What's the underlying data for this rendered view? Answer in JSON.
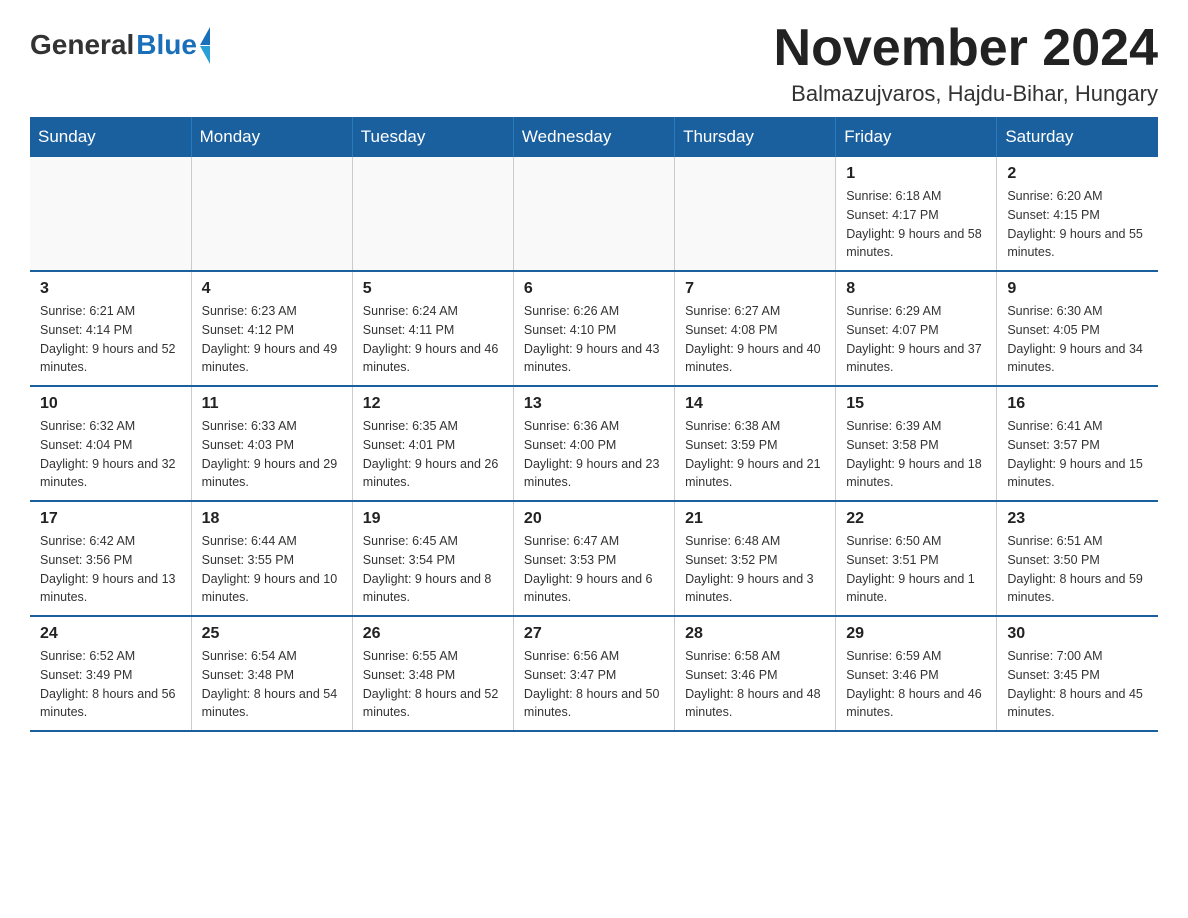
{
  "header": {
    "logo": {
      "general": "General",
      "blue": "Blue"
    },
    "title": "November 2024",
    "location": "Balmazujvaros, Hajdu-Bihar, Hungary"
  },
  "weekdays": [
    "Sunday",
    "Monday",
    "Tuesday",
    "Wednesday",
    "Thursday",
    "Friday",
    "Saturday"
  ],
  "weeks": [
    [
      {
        "day": "",
        "info": ""
      },
      {
        "day": "",
        "info": ""
      },
      {
        "day": "",
        "info": ""
      },
      {
        "day": "",
        "info": ""
      },
      {
        "day": "",
        "info": ""
      },
      {
        "day": "1",
        "info": "Sunrise: 6:18 AM\nSunset: 4:17 PM\nDaylight: 9 hours and 58 minutes."
      },
      {
        "day": "2",
        "info": "Sunrise: 6:20 AM\nSunset: 4:15 PM\nDaylight: 9 hours and 55 minutes."
      }
    ],
    [
      {
        "day": "3",
        "info": "Sunrise: 6:21 AM\nSunset: 4:14 PM\nDaylight: 9 hours and 52 minutes."
      },
      {
        "day": "4",
        "info": "Sunrise: 6:23 AM\nSunset: 4:12 PM\nDaylight: 9 hours and 49 minutes."
      },
      {
        "day": "5",
        "info": "Sunrise: 6:24 AM\nSunset: 4:11 PM\nDaylight: 9 hours and 46 minutes."
      },
      {
        "day": "6",
        "info": "Sunrise: 6:26 AM\nSunset: 4:10 PM\nDaylight: 9 hours and 43 minutes."
      },
      {
        "day": "7",
        "info": "Sunrise: 6:27 AM\nSunset: 4:08 PM\nDaylight: 9 hours and 40 minutes."
      },
      {
        "day": "8",
        "info": "Sunrise: 6:29 AM\nSunset: 4:07 PM\nDaylight: 9 hours and 37 minutes."
      },
      {
        "day": "9",
        "info": "Sunrise: 6:30 AM\nSunset: 4:05 PM\nDaylight: 9 hours and 34 minutes."
      }
    ],
    [
      {
        "day": "10",
        "info": "Sunrise: 6:32 AM\nSunset: 4:04 PM\nDaylight: 9 hours and 32 minutes."
      },
      {
        "day": "11",
        "info": "Sunrise: 6:33 AM\nSunset: 4:03 PM\nDaylight: 9 hours and 29 minutes."
      },
      {
        "day": "12",
        "info": "Sunrise: 6:35 AM\nSunset: 4:01 PM\nDaylight: 9 hours and 26 minutes."
      },
      {
        "day": "13",
        "info": "Sunrise: 6:36 AM\nSunset: 4:00 PM\nDaylight: 9 hours and 23 minutes."
      },
      {
        "day": "14",
        "info": "Sunrise: 6:38 AM\nSunset: 3:59 PM\nDaylight: 9 hours and 21 minutes."
      },
      {
        "day": "15",
        "info": "Sunrise: 6:39 AM\nSunset: 3:58 PM\nDaylight: 9 hours and 18 minutes."
      },
      {
        "day": "16",
        "info": "Sunrise: 6:41 AM\nSunset: 3:57 PM\nDaylight: 9 hours and 15 minutes."
      }
    ],
    [
      {
        "day": "17",
        "info": "Sunrise: 6:42 AM\nSunset: 3:56 PM\nDaylight: 9 hours and 13 minutes."
      },
      {
        "day": "18",
        "info": "Sunrise: 6:44 AM\nSunset: 3:55 PM\nDaylight: 9 hours and 10 minutes."
      },
      {
        "day": "19",
        "info": "Sunrise: 6:45 AM\nSunset: 3:54 PM\nDaylight: 9 hours and 8 minutes."
      },
      {
        "day": "20",
        "info": "Sunrise: 6:47 AM\nSunset: 3:53 PM\nDaylight: 9 hours and 6 minutes."
      },
      {
        "day": "21",
        "info": "Sunrise: 6:48 AM\nSunset: 3:52 PM\nDaylight: 9 hours and 3 minutes."
      },
      {
        "day": "22",
        "info": "Sunrise: 6:50 AM\nSunset: 3:51 PM\nDaylight: 9 hours and 1 minute."
      },
      {
        "day": "23",
        "info": "Sunrise: 6:51 AM\nSunset: 3:50 PM\nDaylight: 8 hours and 59 minutes."
      }
    ],
    [
      {
        "day": "24",
        "info": "Sunrise: 6:52 AM\nSunset: 3:49 PM\nDaylight: 8 hours and 56 minutes."
      },
      {
        "day": "25",
        "info": "Sunrise: 6:54 AM\nSunset: 3:48 PM\nDaylight: 8 hours and 54 minutes."
      },
      {
        "day": "26",
        "info": "Sunrise: 6:55 AM\nSunset: 3:48 PM\nDaylight: 8 hours and 52 minutes."
      },
      {
        "day": "27",
        "info": "Sunrise: 6:56 AM\nSunset: 3:47 PM\nDaylight: 8 hours and 50 minutes."
      },
      {
        "day": "28",
        "info": "Sunrise: 6:58 AM\nSunset: 3:46 PM\nDaylight: 8 hours and 48 minutes."
      },
      {
        "day": "29",
        "info": "Sunrise: 6:59 AM\nSunset: 3:46 PM\nDaylight: 8 hours and 46 minutes."
      },
      {
        "day": "30",
        "info": "Sunrise: 7:00 AM\nSunset: 3:45 PM\nDaylight: 8 hours and 45 minutes."
      }
    ]
  ]
}
